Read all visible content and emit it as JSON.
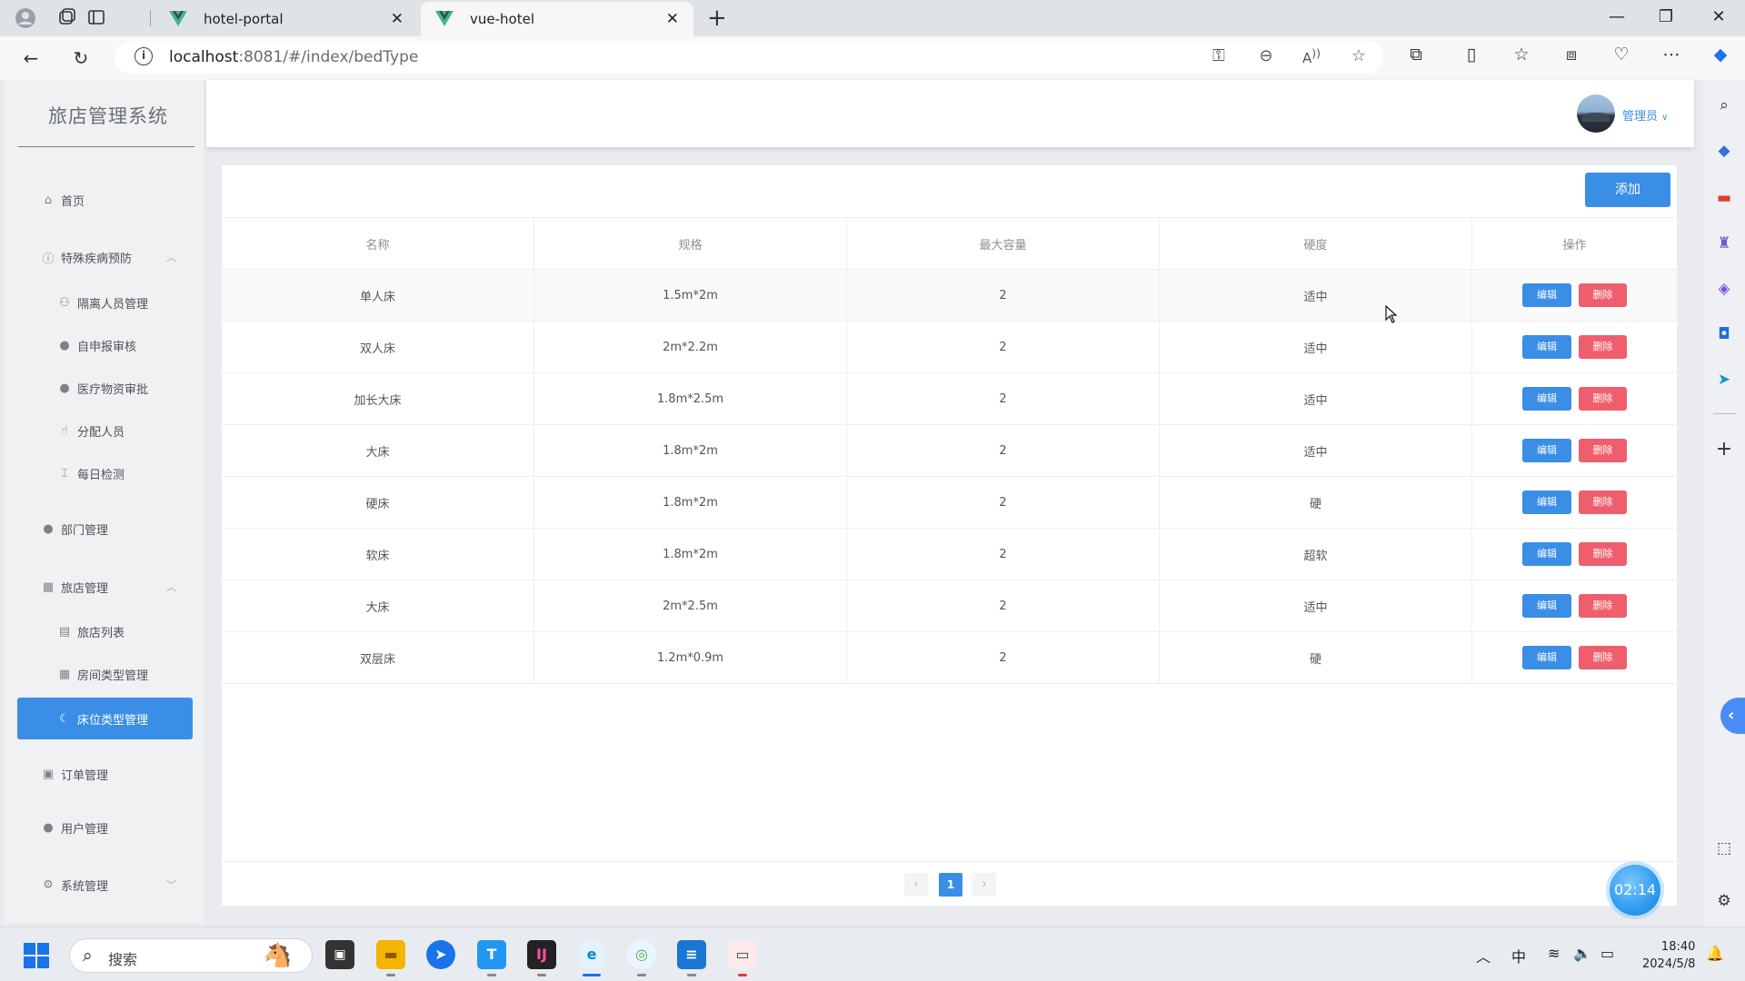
{
  "browser": {
    "tabs": [
      {
        "label": "hotel-portal",
        "active": false
      },
      {
        "label": "vue-hotel",
        "active": true
      }
    ],
    "url_host": "localhost",
    "url_rest": ":8081/#/index/bedType"
  },
  "app": {
    "title": "旅店管理系统",
    "user": "管理员"
  },
  "sidebar": {
    "items": [
      {
        "label": "首页",
        "icon": "home-icon"
      },
      {
        "label": "特殊疾病预防",
        "icon": "info-circle-icon",
        "expanded": true
      },
      {
        "label": "隔离人员管理",
        "icon": "user-outline-icon"
      },
      {
        "label": "自申报审核",
        "icon": "user-solid-icon"
      },
      {
        "label": "医疗物资审批",
        "icon": "user-solid-icon"
      },
      {
        "label": "分配人员",
        "icon": "thumb-icon"
      },
      {
        "label": "每日检测",
        "icon": "thermometer-icon"
      },
      {
        "label": "部门管理",
        "icon": "user-solid-icon"
      },
      {
        "label": "旅店管理",
        "icon": "building-icon",
        "expanded": true
      },
      {
        "label": "旅店列表",
        "icon": "document-icon"
      },
      {
        "label": "房间类型管理",
        "icon": "grid-icon"
      },
      {
        "label": "床位类型管理",
        "icon": "bed-icon",
        "active": true
      },
      {
        "label": "订单管理",
        "icon": "clipboard-icon"
      },
      {
        "label": "用户管理",
        "icon": "user-solid-icon"
      },
      {
        "label": "系统管理",
        "icon": "gear-icon",
        "expanded": false
      }
    ]
  },
  "toolbar": {
    "add_label": "添加"
  },
  "table": {
    "headers": [
      "名称",
      "规格",
      "最大容量",
      "硬度",
      "操作"
    ],
    "rows": [
      [
        "单人床",
        "1.5m*2m",
        "2",
        "适中"
      ],
      [
        "双人床",
        "2m*2.2m",
        "2",
        "适中"
      ],
      [
        "加长大床",
        "1.8m*2.5m",
        "2",
        "适中"
      ],
      [
        "大床",
        "1.8m*2m",
        "2",
        "适中"
      ],
      [
        "硬床",
        "1.8m*2m",
        "2",
        "硬"
      ],
      [
        "软床",
        "1.8m*2m",
        "2",
        "超软"
      ],
      [
        "大床",
        "2m*2.5m",
        "2",
        "适中"
      ],
      [
        "双层床",
        "1.2m*0.9m",
        "2",
        "硬"
      ]
    ],
    "edit_label": "编辑",
    "delete_label": "删除"
  },
  "pagination": {
    "current": "1"
  },
  "timer": "02:14",
  "taskbar": {
    "search_placeholder": "搜索",
    "ime": "中",
    "time": "18:40",
    "date": "2024/5/8"
  },
  "colors": {
    "primary": "#3a8ee6",
    "danger": "#ee5e6c"
  }
}
